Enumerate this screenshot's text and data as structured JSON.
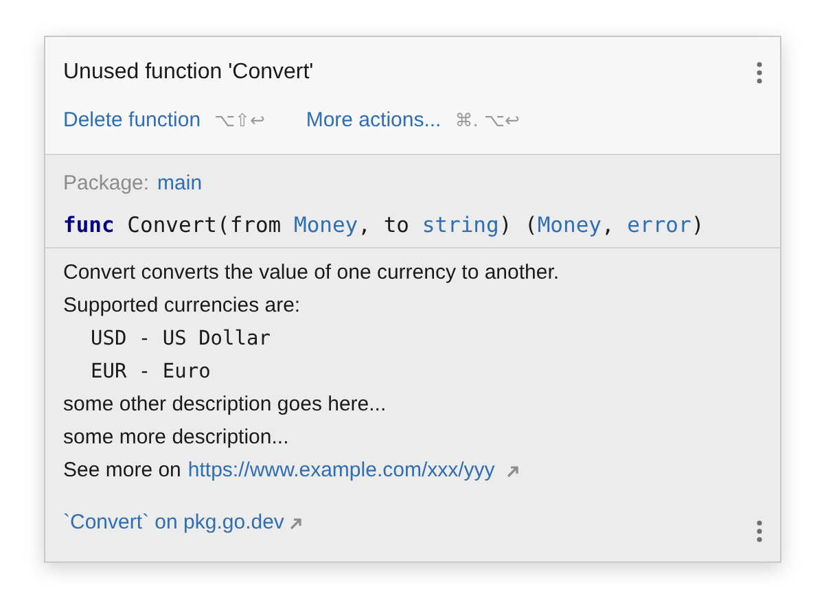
{
  "popup": {
    "title": "Unused function 'Convert'",
    "actions": [
      {
        "label": "Delete function",
        "shortcut": "⌥⇧↩"
      },
      {
        "label": "More actions...",
        "shortcut": "⌘. ⌥↩"
      }
    ],
    "package": {
      "label": "Package:",
      "name": "main"
    },
    "signature": [
      {
        "text": "func",
        "kind": "keyword"
      },
      {
        "text": " Convert(from ",
        "kind": "plain"
      },
      {
        "text": "Money",
        "kind": "type"
      },
      {
        "text": ", to ",
        "kind": "plain"
      },
      {
        "text": "string",
        "kind": "type"
      },
      {
        "text": ") (",
        "kind": "plain"
      },
      {
        "text": "Money",
        "kind": "type"
      },
      {
        "text": ", ",
        "kind": "plain"
      },
      {
        "text": "error",
        "kind": "type"
      },
      {
        "text": ")",
        "kind": "plain"
      }
    ],
    "description": [
      {
        "kind": "text",
        "text": "Convert converts the value of one currency to another."
      },
      {
        "kind": "text",
        "text": "Supported currencies are:"
      },
      {
        "kind": "code",
        "text": "USD - US Dollar"
      },
      {
        "kind": "code",
        "text": "EUR - Euro"
      },
      {
        "kind": "text",
        "text": "some other description goes here..."
      },
      {
        "kind": "text",
        "text": "some more description..."
      },
      {
        "kind": "link",
        "text": "See more on",
        "link": "https://www.example.com/xxx/yyy"
      }
    ],
    "footer_link": "`Convert` on pkg.go.dev"
  }
}
